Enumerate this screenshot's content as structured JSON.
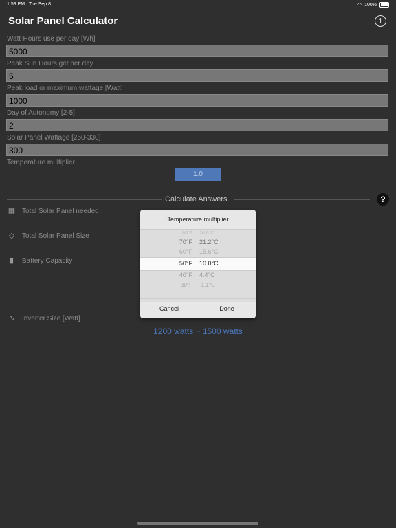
{
  "status": {
    "time": "1:59 PM",
    "date": "Tue Sep 8",
    "battery": "100%"
  },
  "header": {
    "title": "Solar Panel Calculator",
    "info_icon": "info-icon"
  },
  "fields": [
    {
      "label": "Watt-Hours use per day [Wh]",
      "value": "5000"
    },
    {
      "label": "Peak Sun Hours get per day",
      "value": "5"
    },
    {
      "label": "Peak load or maximum wattage [Watt]",
      "value": "1000"
    },
    {
      "label": "Day of Autonomy [2-5]",
      "value": "2"
    },
    {
      "label": "Solar Panel Wattage [250-330]",
      "value": "300"
    }
  ],
  "temperature": {
    "label": "Temperature multiplier",
    "button": "1.0"
  },
  "calculate": {
    "label": "Calculate Answers",
    "help": "?"
  },
  "results": [
    {
      "icon": "solar-panel-icon",
      "label": "Total Solar Panel needed"
    },
    {
      "icon": "panel-size-icon",
      "label": "Total Solar Panel Size"
    },
    {
      "icon": "battery-icon",
      "label": "Battery Capacity"
    },
    {
      "icon": "inverter-icon",
      "label": "Inverter Size [Watt]"
    }
  ],
  "inverter_value": "1200 watts ~ 1500 watts",
  "picker": {
    "title": "Temperature multiplier",
    "rows": [
      {
        "f": "80°F",
        "c": "26.6°C"
      },
      {
        "f": "70°F",
        "c": "21.2°C"
      },
      {
        "f": "60°F",
        "c": "15.6°C"
      },
      {
        "f": "50°F",
        "c": "10.0°C"
      },
      {
        "f": "40°F",
        "c": "4.4°C"
      },
      {
        "f": "30°F",
        "c": "-1.1°C"
      }
    ],
    "cancel": "Cancel",
    "done": "Done"
  }
}
